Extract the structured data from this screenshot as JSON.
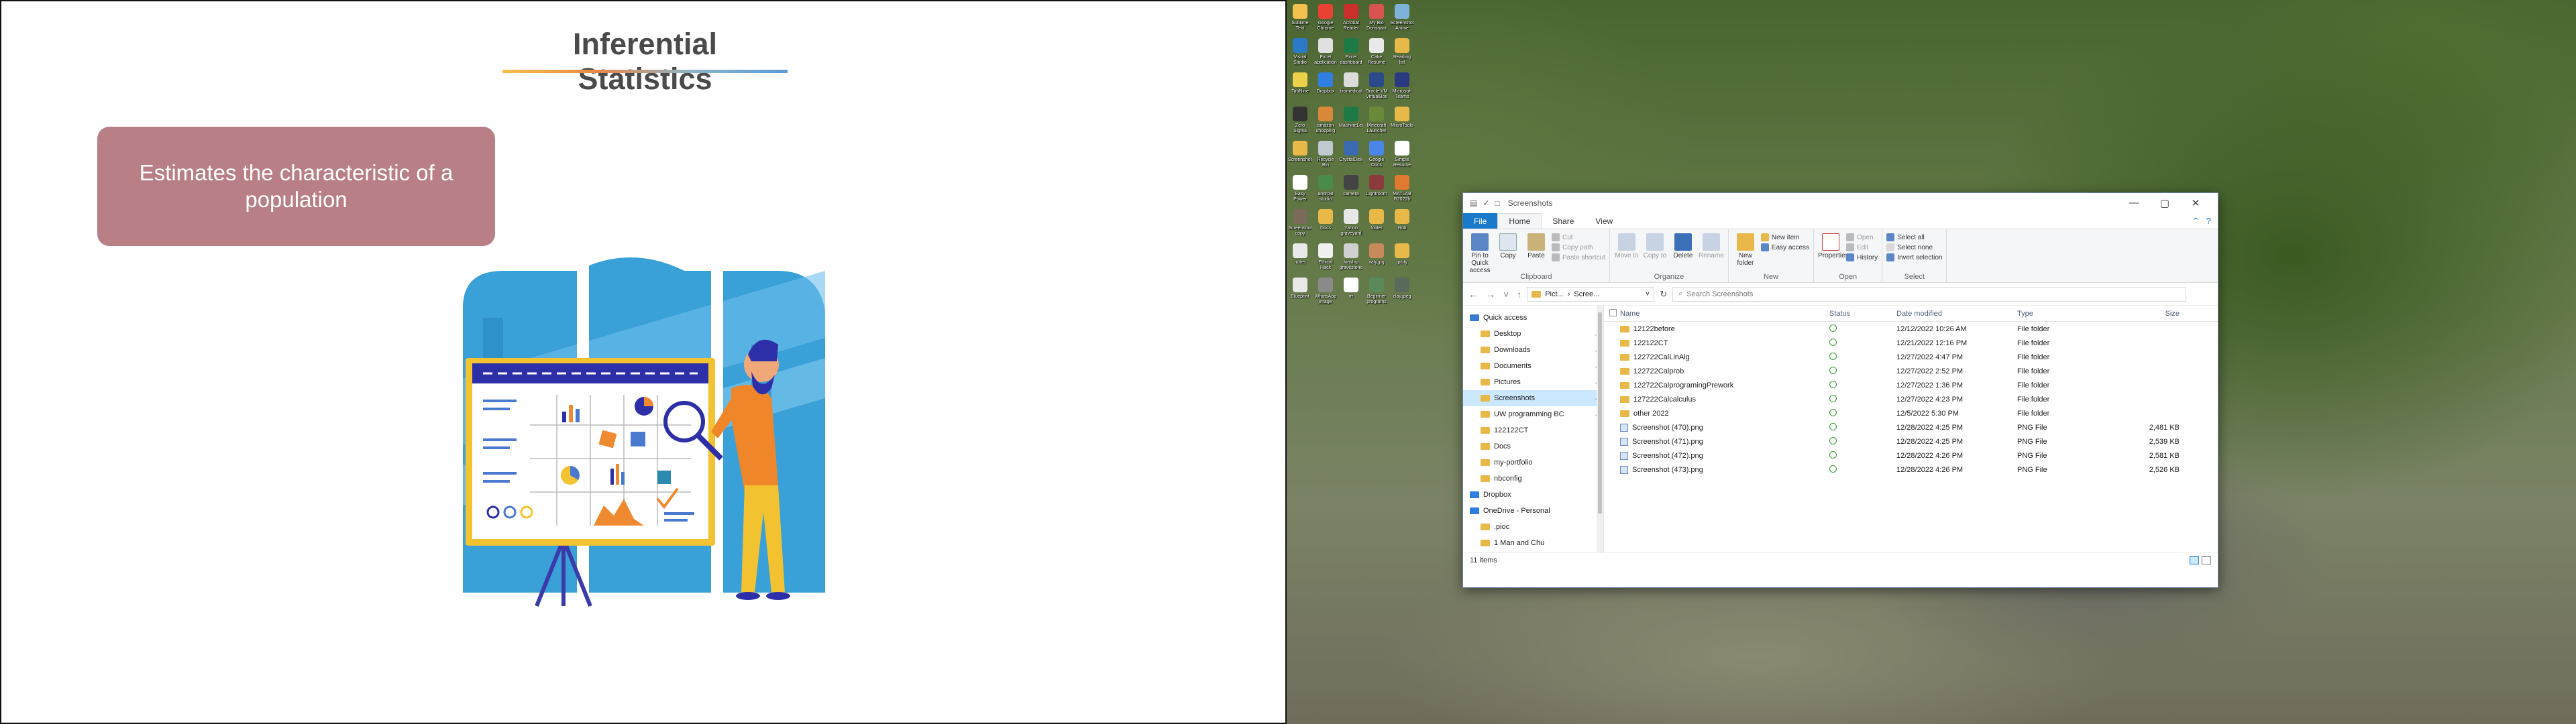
{
  "slide": {
    "title": "Inferential Statistics",
    "callout": "Estimates the characteristic of a population"
  },
  "desktop": {
    "icons": [
      {
        "label": "Sublime Text",
        "color": "#f2c14e"
      },
      {
        "label": "Google Chrome",
        "color": "#e94235"
      },
      {
        "label": "Acrobat Reader",
        "color": "#c9302c"
      },
      {
        "label": "My Bio Dominant",
        "color": "#d9534f"
      },
      {
        "label": "Screenshot Anime",
        "color": "#7fb2d8"
      },
      {
        "label": "Visual Studio Code",
        "color": "#2a7ac7"
      },
      {
        "label": "Excel application",
        "color": "#e0e0e0"
      },
      {
        "label": "Excel dashboard",
        "color": "#1e7a45"
      },
      {
        "label": "Cake Resume",
        "color": "#e9e9e9"
      },
      {
        "label": "Reading list",
        "color": "#e8b949"
      },
      {
        "label": "TabNine",
        "color": "#eed14b"
      },
      {
        "label": "Dropbox",
        "color": "#2f7fe3"
      },
      {
        "label": "biomedical",
        "color": "#dcdcdc"
      },
      {
        "label": "Oracle VM VirtualBox",
        "color": "#2b4a8a"
      },
      {
        "label": "Microsoft Teams",
        "color": "#2b3a80"
      },
      {
        "label": "Zero Sigma",
        "color": "#333333"
      },
      {
        "label": "amazon shopping",
        "color": "#d88a3a"
      },
      {
        "label": "MachineLearning",
        "color": "#1e7a45"
      },
      {
        "label": "Minecraft Launcher",
        "color": "#6a8a3a"
      },
      {
        "label": "MicroTools",
        "color": "#e8b949"
      },
      {
        "label": "Screenshots",
        "color": "#e8b949"
      },
      {
        "label": "Recycle Bin",
        "color": "#c0c8d0"
      },
      {
        "label": "CrystalDisk",
        "color": "#3a6ab0"
      },
      {
        "label": "Google Docs",
        "color": "#4a86e8"
      },
      {
        "label": "Simple Resume",
        "color": "#ffffff"
      },
      {
        "label": "Easy Power",
        "color": "#ffffff"
      },
      {
        "label": "android studio",
        "color": "#4a8a4a"
      },
      {
        "label": "camera",
        "color": "#444444"
      },
      {
        "label": "Lightroom",
        "color": "#8a3a3a"
      },
      {
        "label": "MATLAB R2022b",
        "color": "#e07a30"
      },
      {
        "label": "Screenshot copy",
        "color": "#7a6a5a"
      },
      {
        "label": "Docs",
        "color": "#e8b949"
      },
      {
        "label": "Yahoo graveyard",
        "color": "#e8e8e8"
      },
      {
        "label": "folder",
        "color": "#e8b949"
      },
      {
        "label": "Roll",
        "color": "#e8b949"
      },
      {
        "label": "notes",
        "color": "#e8e8e8"
      },
      {
        "label": "Ethical Hack",
        "color": "#f0f0f0"
      },
      {
        "label": "kinship gravestone",
        "color": "#d0d0d0"
      },
      {
        "label": "italy.jpg",
        "color": "#c88a5a"
      },
      {
        "label": "jpcity",
        "color": "#e8b949"
      },
      {
        "label": "Blueprint",
        "color": "#e8e8e8"
      },
      {
        "label": "WhatsApp image 2022...",
        "color": "#8a8a8a"
      },
      {
        "label": "rrr",
        "color": "#ffffff"
      },
      {
        "label": "Beginner programs",
        "color": "#5a8a5a"
      },
      {
        "label": "clay.jpeg",
        "color": "#5a6a5a"
      }
    ]
  },
  "explorer": {
    "window_title": "Screenshots",
    "quick_access_symbols": [
      "▤",
      "✓",
      "□"
    ],
    "controls": {
      "minimize": "—",
      "maximize": "▢",
      "close": "✕"
    },
    "tabs": {
      "file": "File",
      "home": "Home",
      "share": "Share",
      "view": "View"
    },
    "ribbon": {
      "clipboard": {
        "label": "Clipboard",
        "pin": "Pin to Quick access",
        "copy": "Copy",
        "paste": "Paste",
        "cut": "Cut",
        "copy_path": "Copy path",
        "paste_shortcut": "Paste shortcut"
      },
      "organize": {
        "label": "Organize",
        "move_to": "Move to",
        "copy_to": "Copy to",
        "delete": "Delete",
        "rename": "Rename"
      },
      "new": {
        "label": "New",
        "new_folder": "New folder",
        "new_item": "New item",
        "easy_access": "Easy access"
      },
      "open": {
        "label": "Open",
        "properties": "Properties",
        "open": "Open",
        "edit": "Edit",
        "history": "History"
      },
      "select": {
        "label": "Select",
        "select_all": "Select all",
        "select_none": "Select none",
        "invert": "Invert selection"
      }
    },
    "address": {
      "back": "←",
      "forward": "→",
      "recent": "˅",
      "up": "↑",
      "path": [
        "Pict...",
        "Scree..."
      ],
      "refresh": "↻",
      "search_placeholder": "Search Screenshots"
    },
    "nav_items": [
      {
        "label": "Quick access",
        "sub": false,
        "pinned": false,
        "selected": false
      },
      {
        "label": "Desktop",
        "sub": true,
        "pinned": true,
        "selected": false
      },
      {
        "label": "Downloads",
        "sub": true,
        "pinned": true,
        "selected": false
      },
      {
        "label": "Documents",
        "sub": true,
        "pinned": true,
        "selected": false
      },
      {
        "label": "Pictures",
        "sub": true,
        "pinned": true,
        "selected": false
      },
      {
        "label": "Screenshots",
        "sub": true,
        "pinned": true,
        "selected": true
      },
      {
        "label": "UW programming BC",
        "sub": true,
        "pinned": true,
        "selected": false
      },
      {
        "label": "122122CT",
        "sub": true,
        "pinned": false,
        "selected": false
      },
      {
        "label": "Docs",
        "sub": true,
        "pinned": false,
        "selected": false
      },
      {
        "label": "my-portfolio",
        "sub": true,
        "pinned": false,
        "selected": false
      },
      {
        "label": "nbconfig",
        "sub": true,
        "pinned": false,
        "selected": false
      },
      {
        "label": "Dropbox",
        "sub": false,
        "pinned": false,
        "selected": false
      },
      {
        "label": "OneDrive - Personal",
        "sub": false,
        "pinned": false,
        "selected": false
      },
      {
        "label": ".pioc",
        "sub": true,
        "pinned": false,
        "selected": false
      },
      {
        "label": "1 Man and Chu",
        "sub": true,
        "pinned": false,
        "selected": false
      }
    ],
    "pin_symbol": "↗",
    "columns": {
      "name": "Name",
      "status": "Status",
      "date": "Date modified",
      "type": "Type",
      "size": "Size"
    },
    "files": [
      {
        "name": "12122before",
        "date": "12/12/2022 10:26 AM",
        "type": "File folder",
        "size": "",
        "kind": "folder"
      },
      {
        "name": "122122CT",
        "date": "12/21/2022 12:16 PM",
        "type": "File folder",
        "size": "",
        "kind": "folder"
      },
      {
        "name": "122722CalLinAlg",
        "date": "12/27/2022 4:47 PM",
        "type": "File folder",
        "size": "",
        "kind": "folder"
      },
      {
        "name": "122722Calprob",
        "date": "12/27/2022 2:52 PM",
        "type": "File folder",
        "size": "",
        "kind": "folder"
      },
      {
        "name": "122722CalprogramingPrework",
        "date": "12/27/2022 1:36 PM",
        "type": "File folder",
        "size": "",
        "kind": "folder"
      },
      {
        "name": "127222Calcalculus",
        "date": "12/27/2022 4:23 PM",
        "type": "File folder",
        "size": "",
        "kind": "folder"
      },
      {
        "name": "other 2022",
        "date": "12/5/2022 5:30 PM",
        "type": "File folder",
        "size": "",
        "kind": "folder"
      },
      {
        "name": "Screenshot (470).png",
        "date": "12/28/2022 4:25 PM",
        "type": "PNG File",
        "size": "2,481 KB",
        "kind": "png"
      },
      {
        "name": "Screenshot (471).png",
        "date": "12/28/2022 4:25 PM",
        "type": "PNG File",
        "size": "2,539 KB",
        "kind": "png"
      },
      {
        "name": "Screenshot (472).png",
        "date": "12/28/2022 4:26 PM",
        "type": "PNG File",
        "size": "2,581 KB",
        "kind": "png"
      },
      {
        "name": "Screenshot (473).png",
        "date": "12/28/2022 4:26 PM",
        "type": "PNG File",
        "size": "2,526 KB",
        "kind": "png"
      }
    ],
    "status_text": "11 items"
  }
}
